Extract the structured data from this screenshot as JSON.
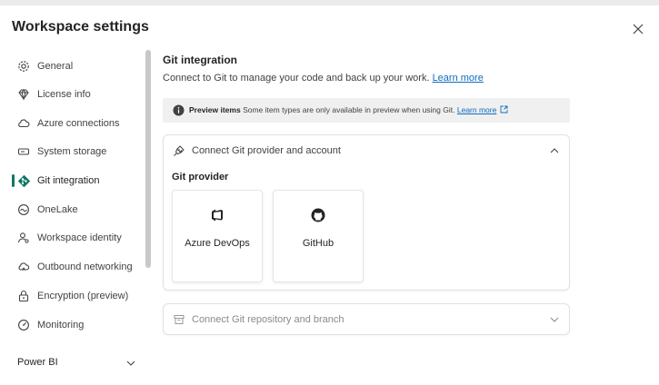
{
  "dialog": {
    "title": "Workspace settings",
    "close_icon": "close-icon"
  },
  "sidebar": {
    "items": [
      {
        "label": "General",
        "icon": "gear-icon"
      },
      {
        "label": "License info",
        "icon": "diamond-icon"
      },
      {
        "label": "Azure connections",
        "icon": "cloud-icon"
      },
      {
        "label": "System storage",
        "icon": "storage-icon"
      },
      {
        "label": "Git integration",
        "icon": "git-icon",
        "active": true
      },
      {
        "label": "OneLake",
        "icon": "onelake-icon"
      },
      {
        "label": "Workspace identity",
        "icon": "identity-icon"
      },
      {
        "label": "Outbound networking",
        "icon": "cloud-network-icon"
      },
      {
        "label": "Encryption (preview)",
        "icon": "lock-icon"
      },
      {
        "label": "Monitoring",
        "icon": "monitoring-icon"
      }
    ],
    "section": {
      "label": "Power BI",
      "icon": "chevron-down-icon"
    }
  },
  "main": {
    "heading": "Git integration",
    "description": "Connect to Git to manage your code and back up your work.",
    "description_link": "Learn more",
    "preview": {
      "bold": "Preview items",
      "text": "Some item types are only available in preview when using Git.",
      "link": "Learn more"
    },
    "connect_card": {
      "title": "Connect Git provider and account",
      "provider_label": "Git provider",
      "providers": [
        {
          "label": "Azure DevOps",
          "icon": "azure-devops-icon"
        },
        {
          "label": "GitHub",
          "icon": "github-icon"
        }
      ]
    },
    "repo_card": {
      "title": "Connect Git repository and branch"
    }
  },
  "colors": {
    "accent": "#117865",
    "link": "#0f6cbd",
    "preview_bg": "#f0f0f0"
  }
}
